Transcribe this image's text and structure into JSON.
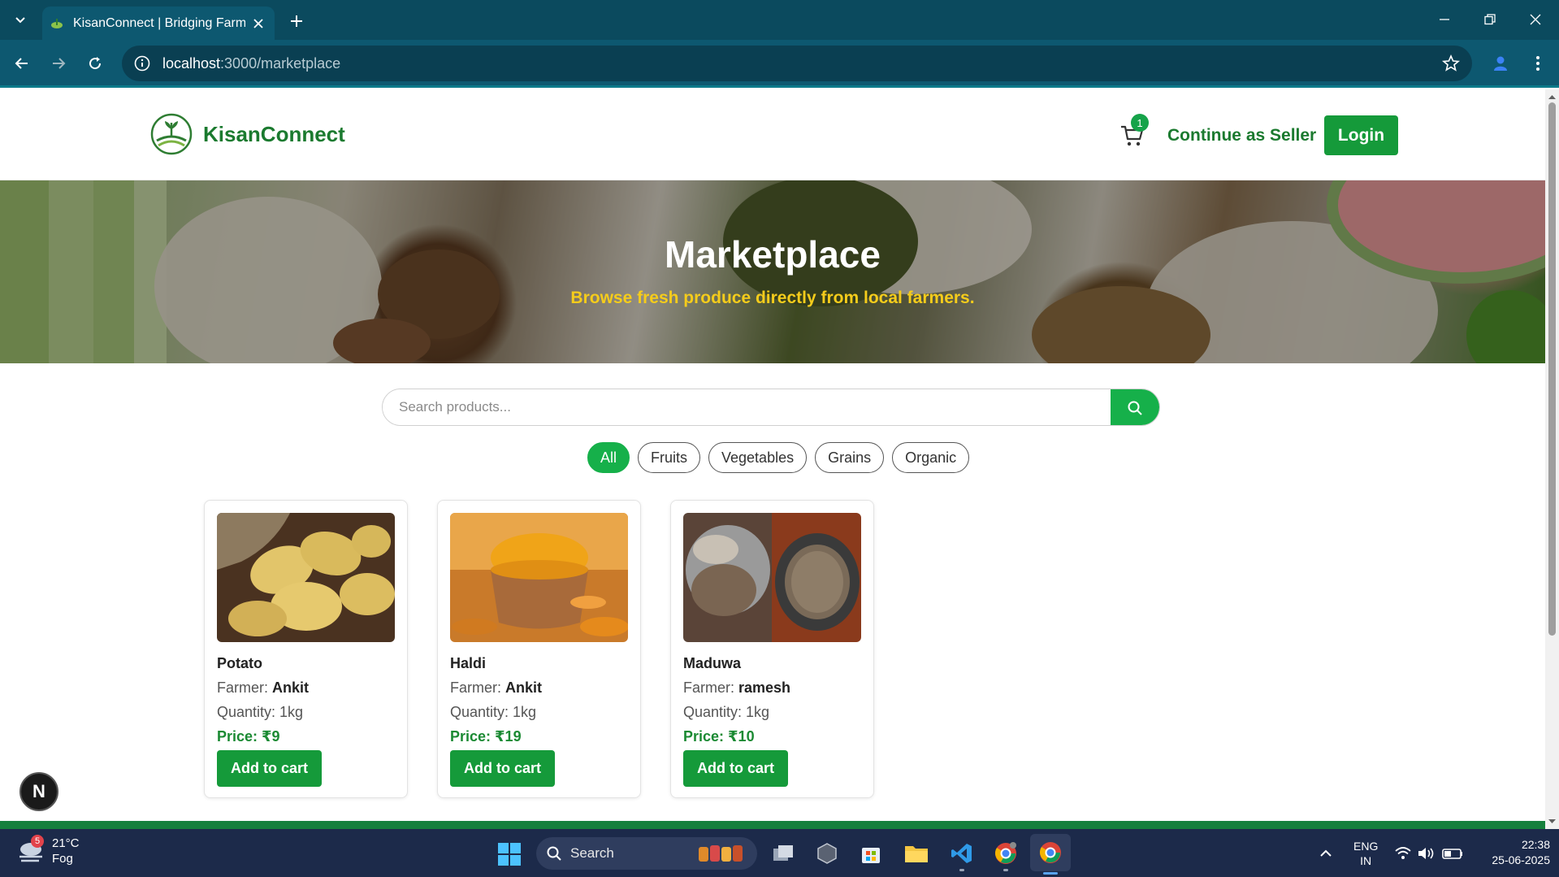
{
  "browser": {
    "tab_title": "KisanConnect | Bridging Farmers",
    "url_host": "localhost",
    "url_path": ":3000/marketplace"
  },
  "header": {
    "brand": "KisanConnect",
    "cart_count": "1",
    "seller_link": "Continue as Seller",
    "login_label": "Login"
  },
  "hero": {
    "title": "Marketplace",
    "subtitle": "Browse fresh produce directly from local farmers."
  },
  "search": {
    "placeholder": "Search products..."
  },
  "filters": [
    "All",
    "Fruits",
    "Vegetables",
    "Grains",
    "Organic"
  ],
  "active_filter": "All",
  "labels": {
    "farmer": "Farmer: ",
    "add_to_cart": "Add to cart"
  },
  "products": [
    {
      "name": "Potato",
      "farmer": "Ankit",
      "quantity": "Quantity: 1kg",
      "price": "Price: ₹9"
    },
    {
      "name": "Haldi",
      "farmer": "Ankit",
      "quantity": "Quantity: 1kg",
      "price": "Price: ₹19"
    },
    {
      "name": "Maduwa",
      "farmer": "ramesh",
      "quantity": "Quantity: 1kg",
      "price": "Price: ₹10"
    }
  ],
  "dev_badge": "N",
  "taskbar": {
    "weather_badge": "5",
    "temperature": "21°C",
    "condition": "Fog",
    "search_label": "Search",
    "lang_line1": "ENG",
    "lang_line2": "IN",
    "time": "22:38",
    "date": "25-06-2025"
  },
  "colors": {
    "brand_green": "#1b7a2f",
    "button_green": "#159a3a",
    "accent_yellow": "#f5cc1b",
    "chrome_teal": "#0d5870"
  }
}
